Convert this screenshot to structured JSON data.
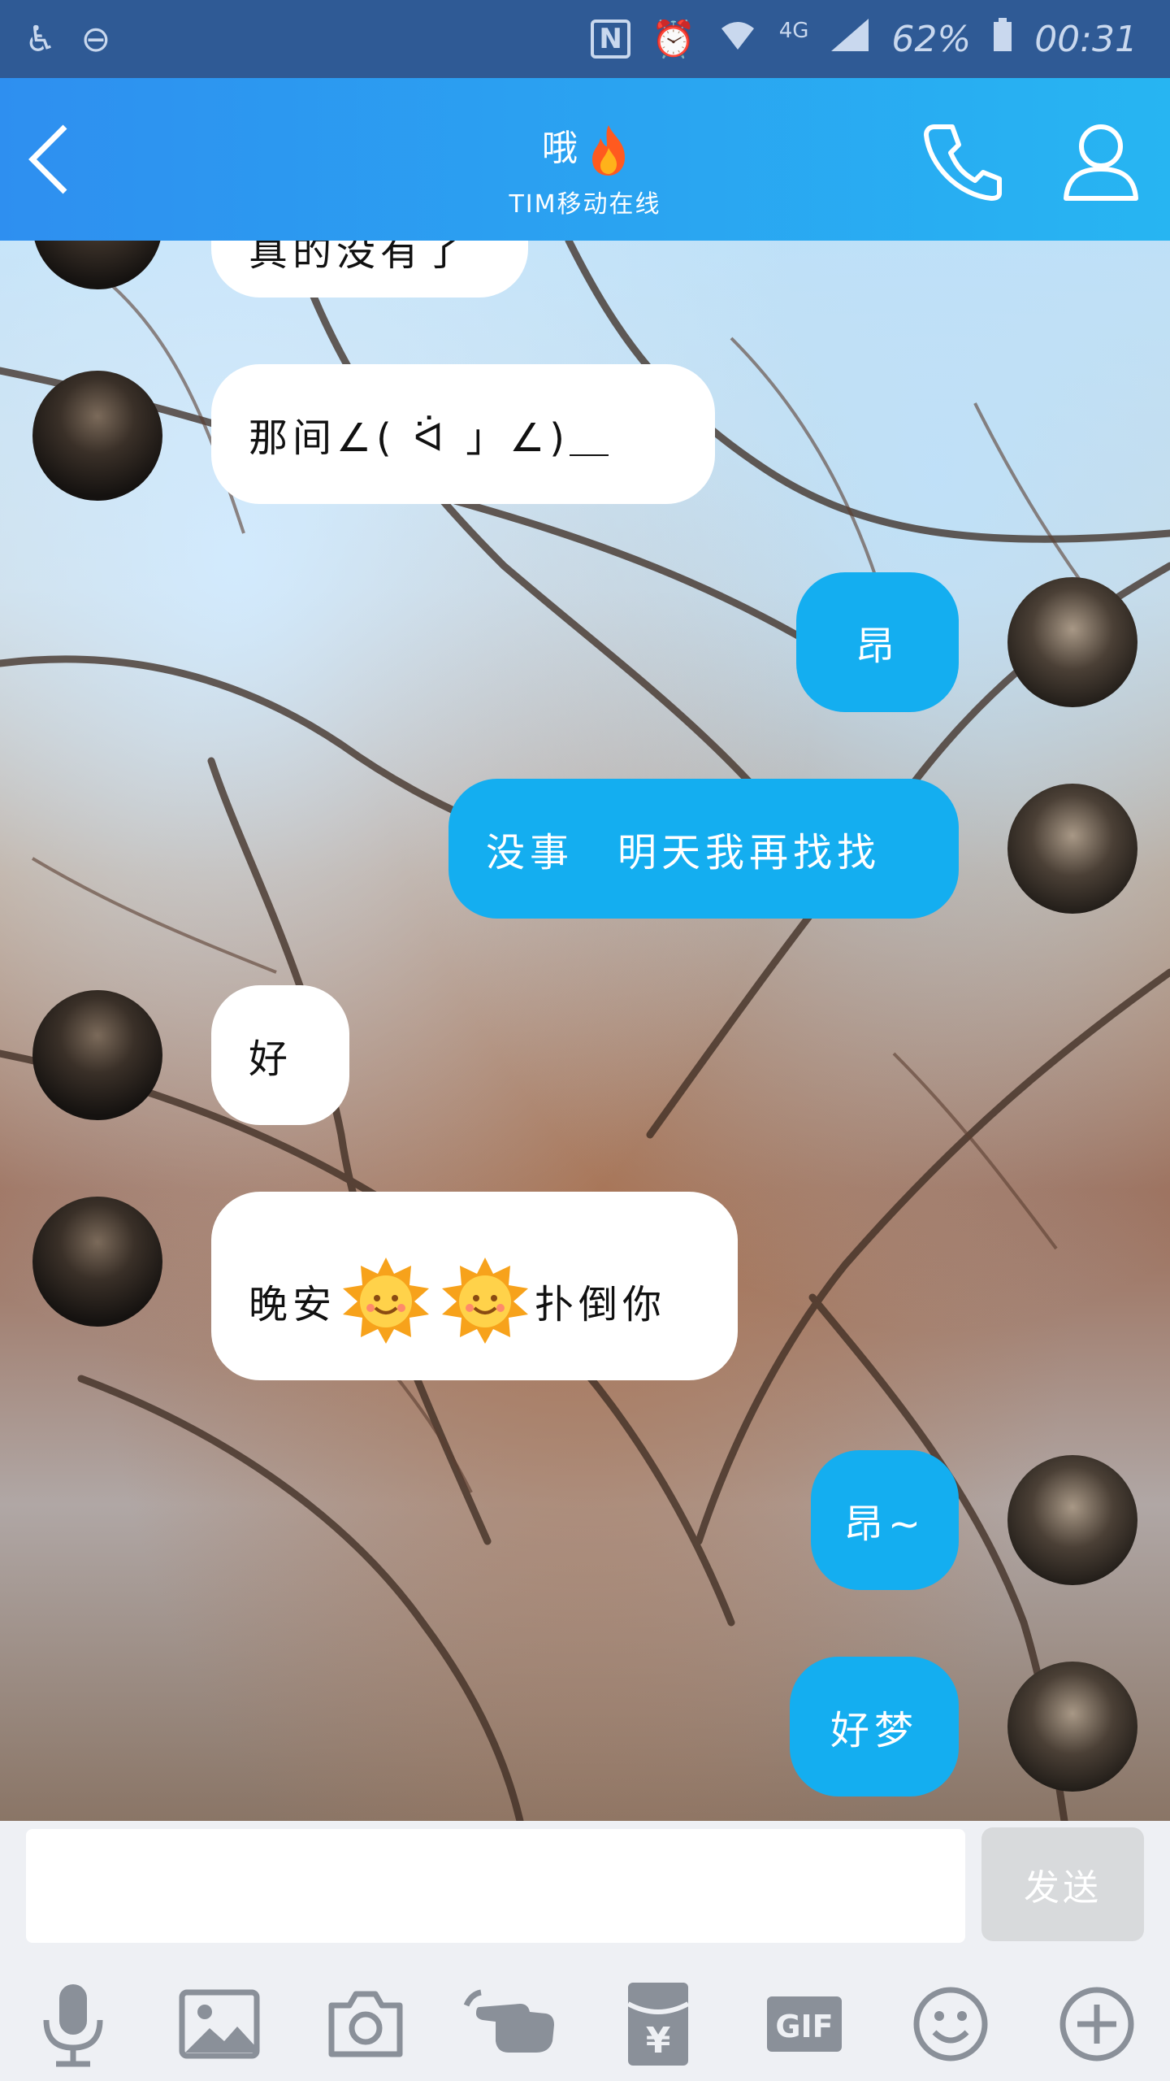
{
  "status_bar": {
    "battery": "62%",
    "time": "00:31",
    "network": "4G"
  },
  "header": {
    "title": "哦",
    "subtitle": "TIM移动在线"
  },
  "messages": [
    {
      "side": "in",
      "text": "真的没有了"
    },
    {
      "side": "in",
      "text": "那间∠( ᐛ 」∠)＿"
    },
    {
      "side": "out",
      "text": "昂"
    },
    {
      "side": "out",
      "text": "没事　明天我再找找"
    },
    {
      "side": "in",
      "text": "好"
    },
    {
      "side": "in",
      "text_before": "晚安",
      "text_after": "扑倒你"
    },
    {
      "side": "out",
      "text": "昂~"
    },
    {
      "side": "out",
      "text": "好梦"
    }
  ],
  "input": {
    "placeholder": "",
    "send_label": "发送"
  },
  "toolbar": {
    "icons": [
      "microphone-icon",
      "image-icon",
      "camera-icon",
      "poke-icon",
      "red-packet-icon",
      "gif-icon",
      "emoji-icon",
      "plus-icon"
    ],
    "gif_label": "GIF",
    "yuan_symbol": "¥"
  },
  "colors": {
    "header_start": "#2e8ff0",
    "header_end": "#27b5f2",
    "outgoing_bubble": "#14aef0",
    "incoming_bubble": "#ffffff"
  }
}
